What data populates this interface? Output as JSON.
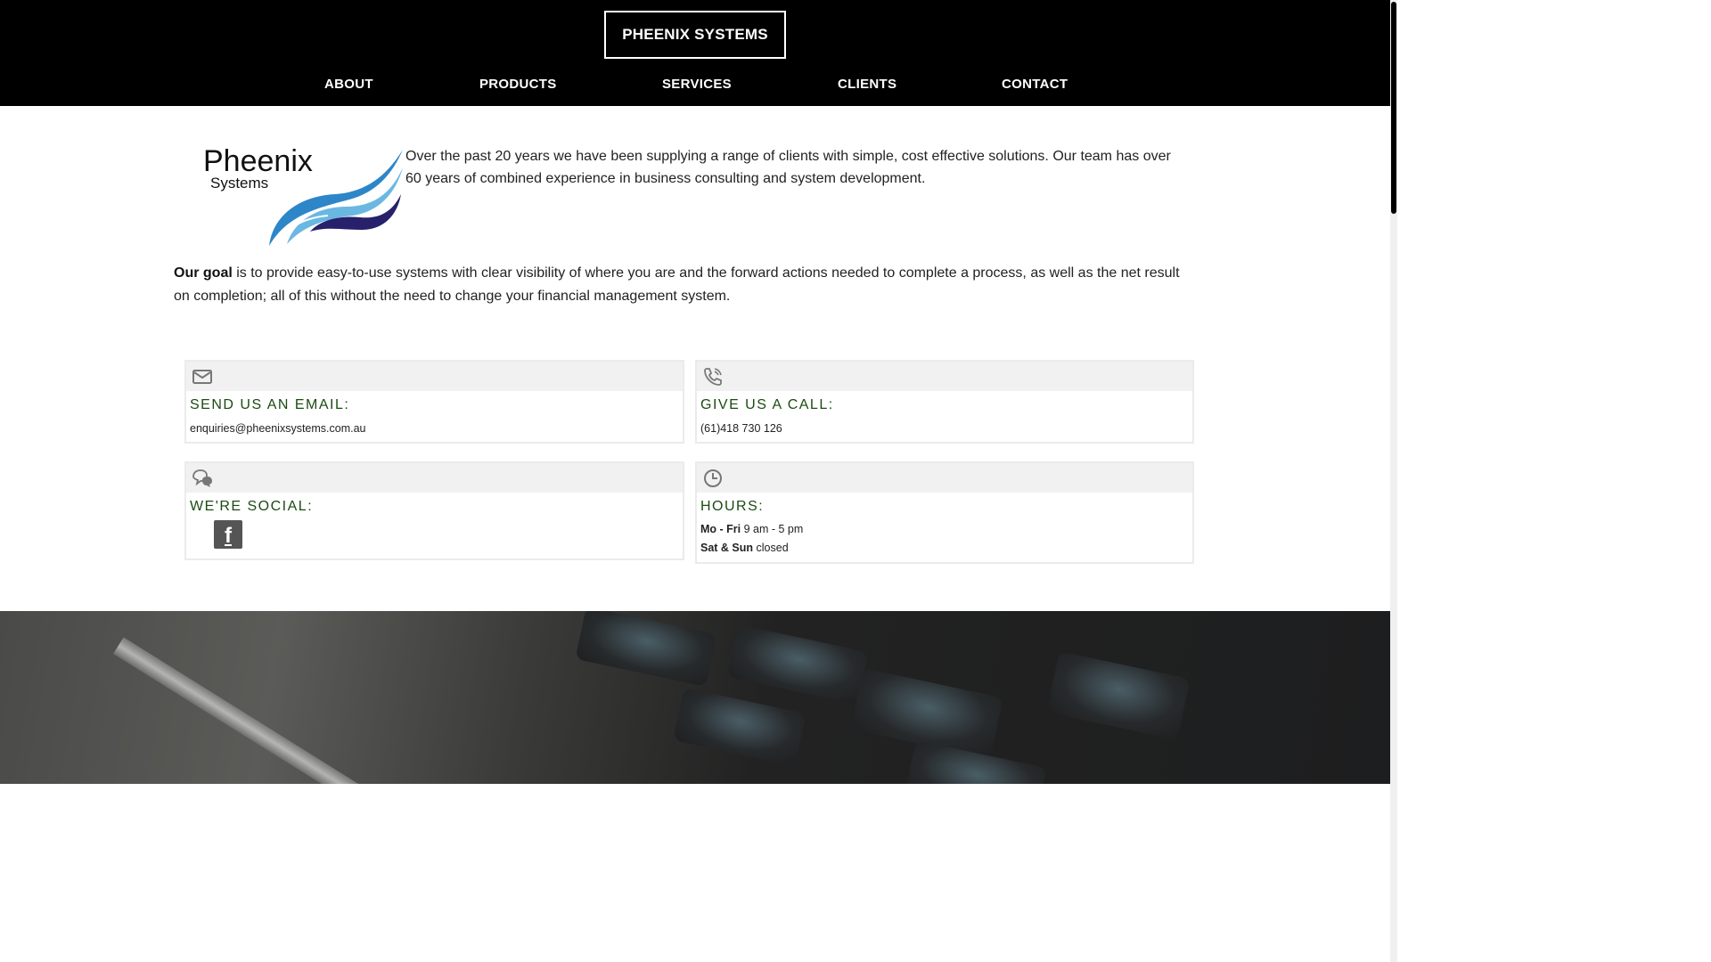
{
  "header": {
    "brand": "PHEENIX SYSTEMS",
    "nav": [
      {
        "label": "ABOUT"
      },
      {
        "label": "PRODUCTS"
      },
      {
        "label": "SERVICES"
      },
      {
        "label": "CLIENTS"
      },
      {
        "label": "CONTACT"
      }
    ]
  },
  "logo": {
    "name": "Pheenix",
    "sub": "Systems"
  },
  "intro": {
    "text": "Over the past 20 years we have been supplying a range of clients with simple, cost effective solutions. Our team has over 60 years of combined experience in business consulting and system development."
  },
  "goal": {
    "lead": "Our goal",
    "text": " is to provide easy-to-use systems with clear visibility of where you are and the forward actions needed to complete a process, as well as the net result on completion; all of this without the need to change your financial management system."
  },
  "contact": {
    "email": {
      "icon": "envelope-icon",
      "title": "SEND US AN EMAIL:",
      "value": "enquiries@pheenixsystems.com.au"
    },
    "phone": {
      "icon": "phone-icon",
      "title": "GIVE US A CALL:",
      "value": "(61)418 730 126"
    },
    "social": {
      "icon": "chat-bubbles-icon",
      "title": "WE'RE SOCIAL:",
      "facebook_icon": "facebook-icon"
    },
    "hours": {
      "icon": "clock-icon",
      "title": "HOURS:",
      "rows": [
        {
          "days": "Mo - Fri",
          "time": " 9 am - 5 pm"
        },
        {
          "days": "Sat & Sun",
          "time": " closed"
        }
      ]
    }
  },
  "colors": {
    "header_bg": "#000000",
    "accent_green": "#1b4b12",
    "card_bar": "#f1f1f1"
  }
}
